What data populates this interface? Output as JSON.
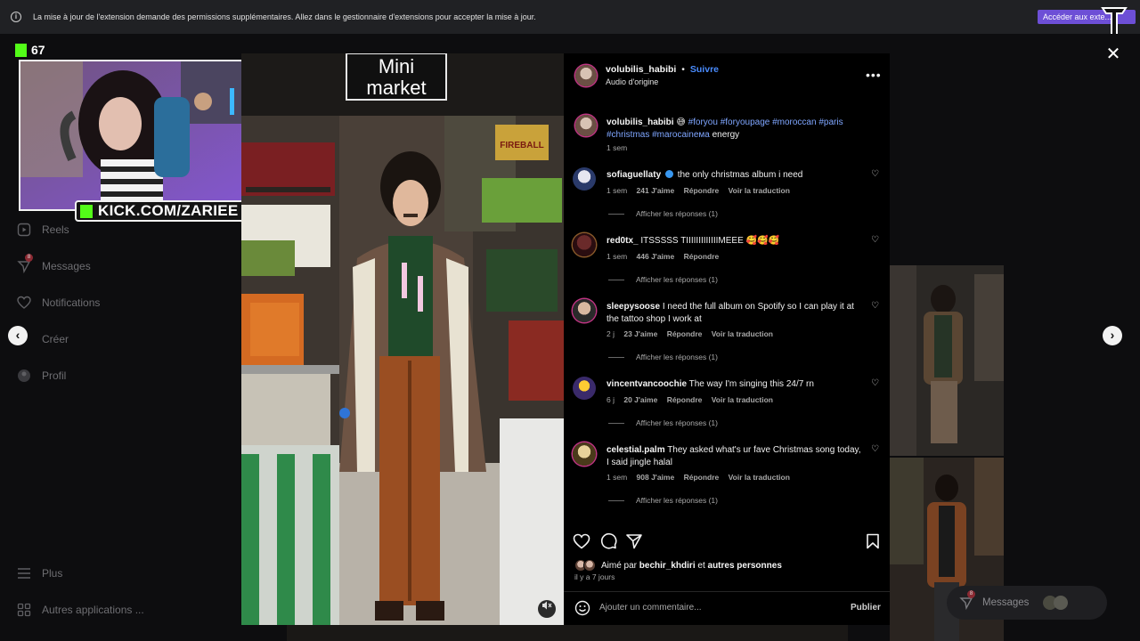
{
  "banner": {
    "message": "La mise à jour de l'extension demande des permissions supplémentaires. Allez dans le gestionnaire d'extensions pour accepter la mise à jour.",
    "button": "Accéder aux exte..."
  },
  "stream": {
    "viewer_count": "67",
    "channel_label": "KICK.COM/ZARIEE"
  },
  "sidebar": {
    "items": [
      {
        "label": "Reels",
        "icon": "reels-icon"
      },
      {
        "label": "Messages",
        "icon": "messages-icon",
        "badge": "8"
      },
      {
        "label": "Notifications",
        "icon": "heart-icon"
      },
      {
        "label": "Créer",
        "icon": "plus-icon"
      },
      {
        "label": "Profil",
        "icon": "profile-icon"
      }
    ],
    "more": "Plus",
    "other_apps": "Autres applications ..."
  },
  "video": {
    "sign_line1": "Mini",
    "sign_line2": "market",
    "crate_label": "FIREBALL"
  },
  "post": {
    "username": "volubilis_habibi",
    "separator": "•",
    "follow": "Suivre",
    "audio": "Audio d'origine",
    "caption_user": "volubilis_habibi",
    "caption_emoji": "😅",
    "caption_tags": "#foryou #foryoupage #moroccan #paris #christmas #marocaineмa",
    "caption_tail": "energy",
    "caption_time": "1 sem",
    "likes_prefix": "Aimé par",
    "likes_user": "bechir_khdiri",
    "likes_and": "et",
    "likes_others": "autres personnes",
    "posted": "il y a 7 jours",
    "comment_placeholder": "Ajouter un commentaire...",
    "publish": "Publier"
  },
  "comments": [
    {
      "user": "sofiaguellaty",
      "verified": true,
      "text": "the only christmas album i need",
      "time": "1 sem",
      "likes": "241 J'aime",
      "reply": "Répondre",
      "translate": "Voir la traduction",
      "replies": "Afficher les réponses (1)"
    },
    {
      "user": "red0tx_",
      "verified": false,
      "text": "ITSSSSS TIIIIIIIIIIIIIMEEE 🥰🥰🥰",
      "time": "1 sem",
      "likes": "446 J'aime",
      "reply": "Répondre",
      "translate": "",
      "replies": "Afficher les réponses (1)"
    },
    {
      "user": "sleepysoose",
      "verified": false,
      "text": "I need the full album on Spotify so I can play it at the tattoo shop I work at",
      "time": "2 j",
      "likes": "23 J'aime",
      "reply": "Répondre",
      "translate": "Voir la traduction",
      "replies": "Afficher les réponses (1)"
    },
    {
      "user": "vincentvancoochie",
      "verified": false,
      "text": "The way I'm singing this 24/7 rn",
      "time": "6 j",
      "likes": "20 J'aime",
      "reply": "Répondre",
      "translate": "Voir la traduction",
      "replies": "Afficher les réponses (1)"
    },
    {
      "user": "celestial.palm",
      "verified": false,
      "text": "They asked what's ur fave Christmas song today, I said jingle halal",
      "time": "1 sem",
      "likes": "908 J'aime",
      "reply": "Répondre",
      "translate": "Voir la traduction",
      "replies": "Afficher les réponses (1)"
    }
  ],
  "messages_pill": {
    "label": "Messages",
    "badge": "8"
  },
  "colors": {
    "kick_green": "#53fc18",
    "link_blue": "#4a8cff",
    "banner_button": "#6d4fd6"
  }
}
